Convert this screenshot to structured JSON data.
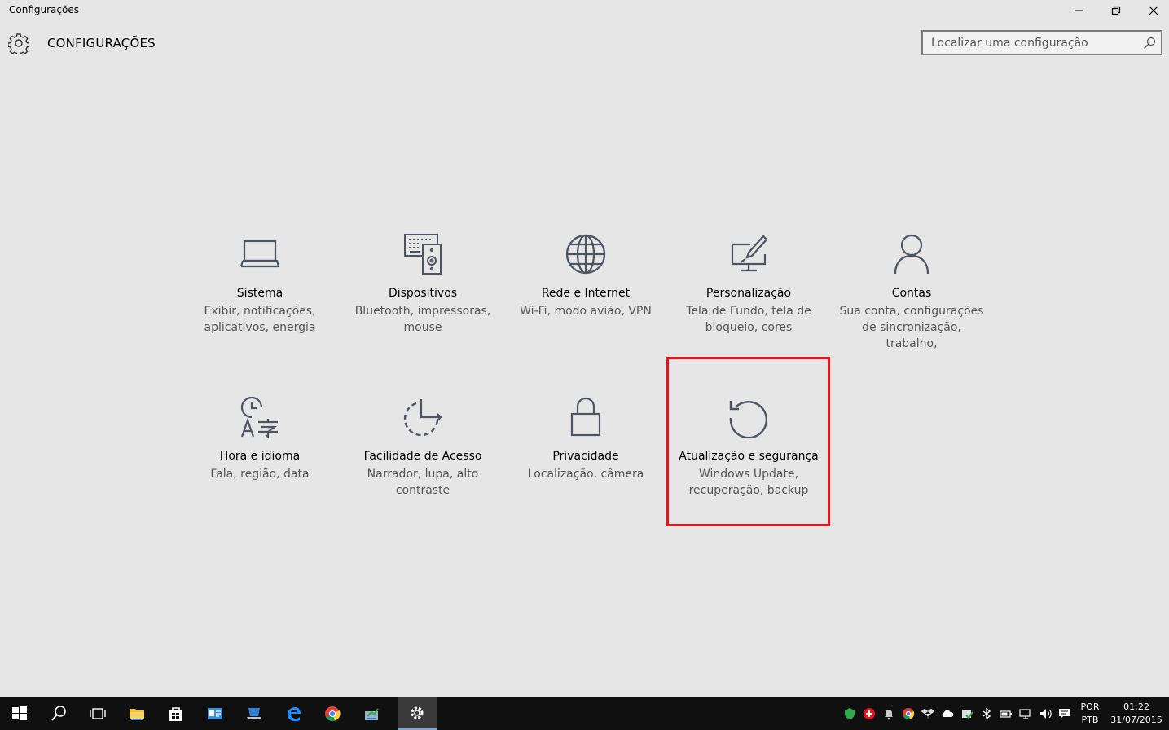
{
  "window": {
    "title": "Configurações"
  },
  "header": {
    "title": "CONFIGURAÇÕES"
  },
  "search": {
    "placeholder": "Localizar uma configuração"
  },
  "tiles": [
    {
      "name": "Sistema",
      "desc": "Exibir, notificações, aplicativos, energia",
      "icon": "laptop-icon"
    },
    {
      "name": "Dispositivos",
      "desc": "Bluetooth, impressoras, mouse",
      "icon": "devices-icon"
    },
    {
      "name": "Rede e Internet",
      "desc": "Wi-Fi, modo avião, VPN",
      "icon": "globe-icon"
    },
    {
      "name": "Personalização",
      "desc": "Tela de Fundo, tela de bloqueio, cores",
      "icon": "paint-monitor-icon"
    },
    {
      "name": "Contas",
      "desc": "Sua conta, configurações de sincronização, trabalho,",
      "icon": "person-icon"
    },
    {
      "name": "Hora e idioma",
      "desc": "Fala, região, data",
      "icon": "clock-language-icon"
    },
    {
      "name": "Facilidade de Acesso",
      "desc": "Narrador, lupa, alto contraste",
      "icon": "ease-of-access-icon"
    },
    {
      "name": "Privacidade",
      "desc": "Localização, câmera",
      "icon": "lock-icon"
    },
    {
      "name": "Atualização e segurança",
      "desc": "Windows Update, recuperação, backup",
      "icon": "refresh-icon"
    }
  ],
  "taskbar": {
    "language": [
      "POR",
      "PTB"
    ],
    "time": "01:22",
    "date": "31/07/2015"
  },
  "colors": {
    "background": "#e6e6e6",
    "highlight": "#e8141c",
    "taskbar": "#101010",
    "icon": "#4d5562"
  }
}
